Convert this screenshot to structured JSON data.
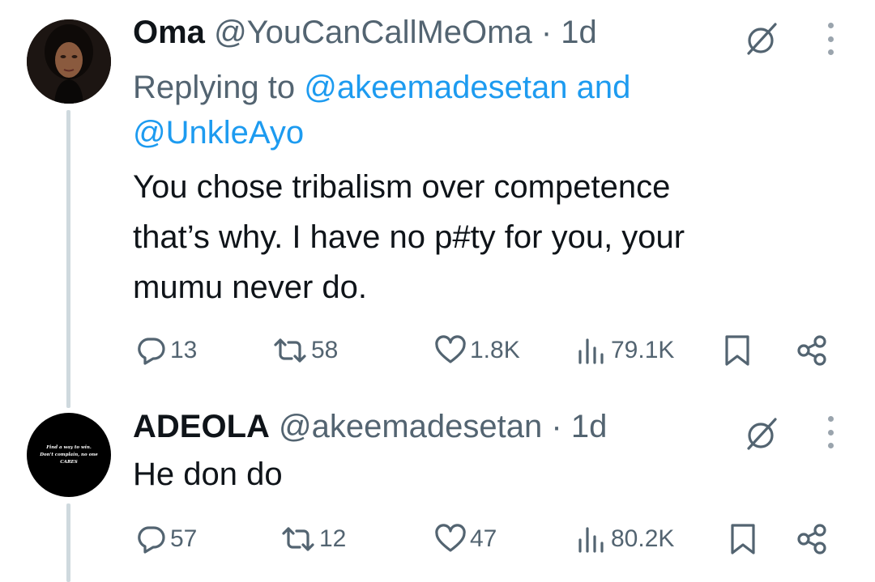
{
  "tweets": [
    {
      "name": "Oma",
      "handle": "@YouCanCallMeOma",
      "time": "· 1d",
      "replying_prefix": "Replying to",
      "replying_to_1": "@akeemadesetan",
      "replying_and": "and",
      "replying_to_2": "@UnkleAyo",
      "text_lines": [
        "You chose tribalism over competence",
        "that’s why. I have no p#ty for you, your",
        "mumu never do."
      ],
      "avatar": "profile-photo-woman",
      "stats": {
        "replies": "13",
        "reposts": "58",
        "likes": "1.8K",
        "views": "79.1K"
      }
    },
    {
      "name": "ADEOLA",
      "handle": "@akeemadesetan",
      "time": "· 1d",
      "text_lines": [
        "He don do"
      ],
      "avatar": "black-avatar-with-quote",
      "avatar_text": [
        "Find a way to win.",
        "Don't complain, no one",
        "CARES"
      ],
      "stats": {
        "replies": "57",
        "reposts": "12",
        "likes": "47",
        "views": "80.2K"
      }
    }
  ],
  "icons": {
    "reply": "reply-icon",
    "repost": "repost-icon",
    "like": "heart-icon",
    "views": "views-icon",
    "bookmark": "bookmark-icon",
    "share": "share-icon",
    "grok": "grok-icon",
    "more": "more-icon"
  },
  "colors": {
    "text": "#0f1419",
    "secondary": "#536471",
    "accent": "#1d9bf0",
    "thread_line": "#cfd9de"
  }
}
